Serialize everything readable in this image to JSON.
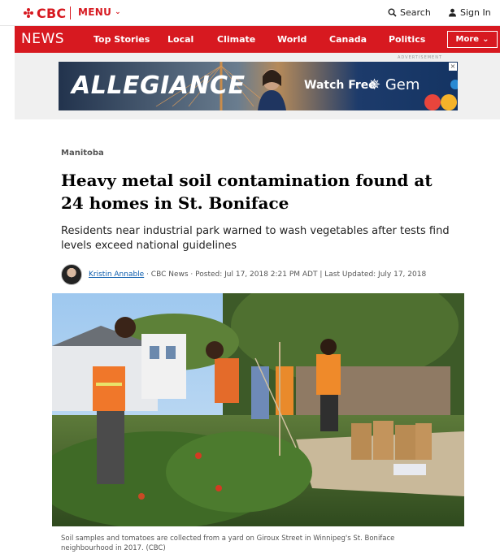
{
  "header": {
    "logo_text": "CBC",
    "menu_label": "MENU",
    "search_label": "Search",
    "signin_label": "Sign In"
  },
  "nav": {
    "section_title": "NEWS",
    "items": [
      "Top Stories",
      "Local",
      "Climate",
      "World",
      "Canada",
      "Politics"
    ],
    "more_label": "More"
  },
  "ad": {
    "label": "ADVERTISEMENT",
    "title": "ALLEGIANCE",
    "watch_text": "Watch Free",
    "brand": "Gem",
    "close": "×"
  },
  "article": {
    "section": "Manitoba",
    "headline": "Heavy metal soil contamination found at 24 homes in St. Boniface",
    "deck": "Residents near industrial park warned to wash vegetables after tests find levels exceed national guidelines",
    "author": "Kristin Annable",
    "byline_rest": " · CBC News · Posted: Jul 17, 2018 2:21 PM ADT | Last Updated: July 17, 2018",
    "caption": "Soil samples and tomatoes are collected from a yard on Giroux Street in Winnipeg's St. Boniface neighbourhood in 2017. (CBC)"
  },
  "colors": {
    "brand_red": "#d71920",
    "link_blue": "#0b5cad"
  }
}
